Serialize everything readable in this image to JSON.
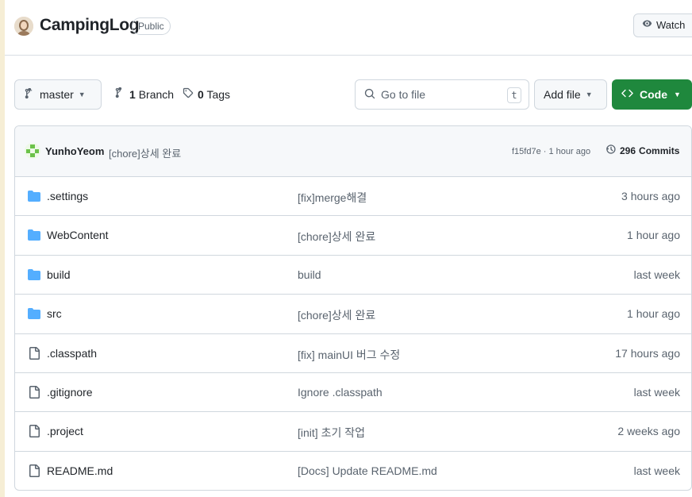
{
  "repo": {
    "name": "CampingLog",
    "visibility": "Public",
    "watch_label": "Watch"
  },
  "toolbar": {
    "branch_label": "master",
    "branches_count": "1",
    "branches_label": "Branch",
    "tags_count": "0",
    "tags_label": "Tags",
    "search_placeholder": "Go to file",
    "search_shortcut": "t",
    "add_file_label": "Add file",
    "code_label": "Code"
  },
  "latest_commit": {
    "author": "YunhoYeom",
    "message": "[chore]상세 완료",
    "meta": "f15fd7e · 1 hour ago",
    "commits_count": "296",
    "commits_label": "Commits"
  },
  "files": [
    {
      "name": ".settings",
      "type": "folder",
      "message": "[fix]merge해결",
      "time": "3 hours ago"
    },
    {
      "name": "WebContent",
      "type": "folder",
      "message": "[chore]상세 완료",
      "time": "1 hour ago"
    },
    {
      "name": "build",
      "type": "folder",
      "message": "build",
      "time": "last week"
    },
    {
      "name": "src",
      "type": "folder",
      "message": "[chore]상세 완료",
      "time": "1 hour ago"
    },
    {
      "name": ".classpath",
      "type": "file",
      "message": "[fix] mainUI 버그 수정",
      "time": "17 hours ago"
    },
    {
      "name": ".gitignore",
      "type": "file",
      "message": "Ignore .classpath",
      "time": "last week"
    },
    {
      "name": ".project",
      "type": "file",
      "message": "[init] 초기 작업",
      "time": "2 weeks ago"
    },
    {
      "name": "README.md",
      "type": "file",
      "message": "[Docs] Update README.md",
      "time": "last week"
    }
  ],
  "colors": {
    "background": "#f6eed5",
    "folder": "#54aeff",
    "code_button": "#1f883d"
  }
}
